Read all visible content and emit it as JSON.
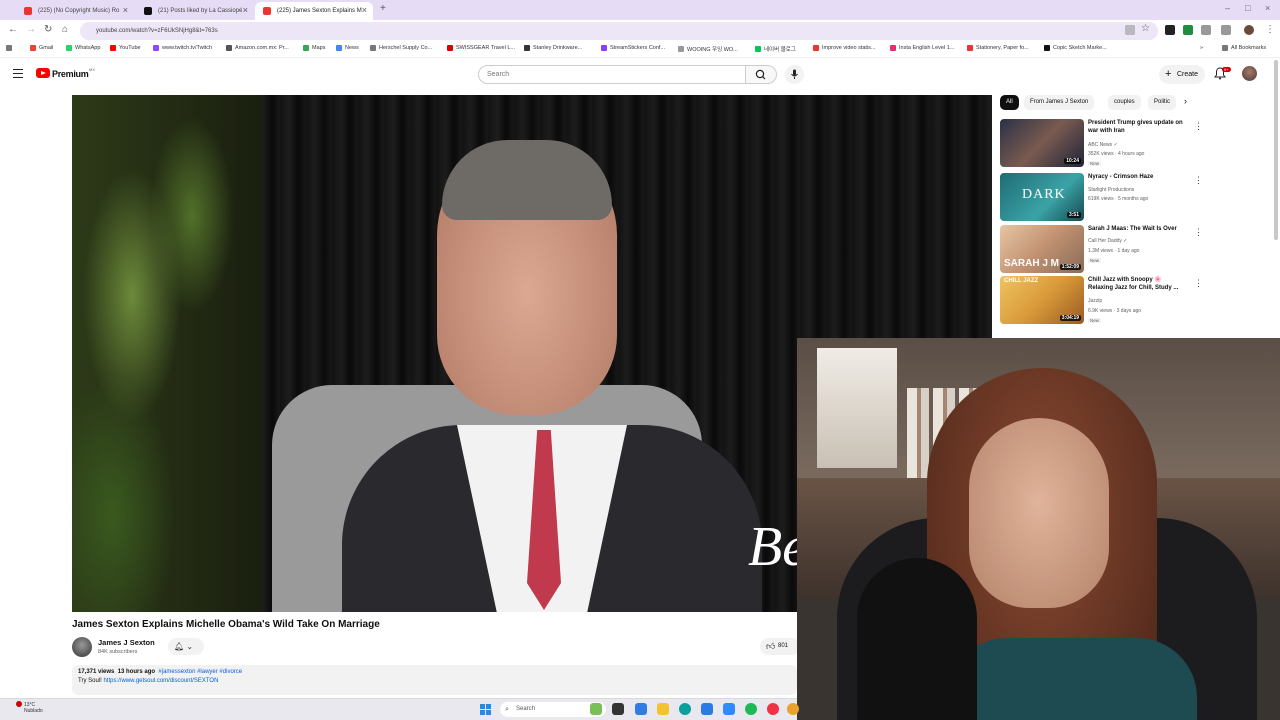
{
  "browser": {
    "tabs": [
      {
        "title": "(225) (No Copyright Music) Ro",
        "favicon": "youtube-icon"
      },
      {
        "title": "(21) Posts liked by La Cassiopé",
        "favicon": "x-icon"
      },
      {
        "title": "(225) James Sexton Explains M",
        "favicon": "youtube-icon",
        "active": true
      }
    ],
    "url": "youtube.com/watch?v=zF6UkSNjHg8&t=763s",
    "bookmarks": [
      "Gmail",
      "WhatsApp",
      "YouTube",
      "www.twitch.tv/Twitch",
      "Amazon.com.mx: Pr...",
      "Maps",
      "News",
      "Herschel Supply Co...",
      "SWISSGEAR Travel L...",
      "Stanley Drinkware...",
      "StreamStickers Conf...",
      "WOOING 우잉 WO...",
      "네이버 블로그",
      "Improve video statis...",
      "Insta English Level 1...",
      "Stationery, Paper fo...",
      "Copic Sketch Marke..."
    ],
    "all_bookmarks": "All Bookmarks"
  },
  "header": {
    "brand": "Premium",
    "country": "MX",
    "search_placeholder": "Search",
    "create_label": "Create",
    "notif_count": "9+"
  },
  "video": {
    "overlay_text": "Be",
    "title": "James Sexton Explains Michelle Obama's Wild Take On Marriage",
    "channel": "James J Sexton",
    "subscribers": "84K subscribers",
    "likes": "801",
    "views": "17,371 views",
    "age": "13 hours ago",
    "tags": "#jamessexton #lawyer #divorce",
    "promo_prefix": "Try Soul!",
    "promo_link": "https://www.getsoul.com/discount/SEXTON"
  },
  "sidebar": {
    "chips": [
      "All",
      "From James J Sexton",
      "couples",
      "Politic"
    ],
    "recommendations": [
      {
        "title": "President Trump gives update on war with Iran",
        "channel": "ABC News",
        "verified": true,
        "views": "352K views · 4 hours ago",
        "badge": "New",
        "duration": "10:24",
        "thumb_color": "#3a3f55"
      },
      {
        "title": "Nyracy - Crimson Haze",
        "channel": "Starlight Productions",
        "verified": false,
        "views": "619K views · 5 months ago",
        "badge": "",
        "duration": "3:51",
        "thumb_color": "#2f7f86",
        "thumb_text": "DARK"
      },
      {
        "title": "Sarah J Maas: The Wait Is Over",
        "channel": "Call Her Daddy",
        "verified": true,
        "views": "1.3M views · 1 day ago",
        "badge": "New",
        "duration": "1:52:09",
        "thumb_color": "#c9a27c",
        "thumb_text": "SARAH J M"
      },
      {
        "title": "Chill Jazz with Snoopy 🌸 Relaxing Jazz for Chill, Study ...",
        "channel": "Jazzip",
        "verified": false,
        "views": "6.9K views · 3 days ago",
        "badge": "New",
        "duration": "3:04:19",
        "thumb_color": "#e2b04a",
        "thumb_text": "CHILL JAZZ"
      }
    ]
  },
  "taskbar": {
    "weather_temp": "13°C",
    "weather_desc": "Nublado",
    "search_placeholder": "Search"
  }
}
